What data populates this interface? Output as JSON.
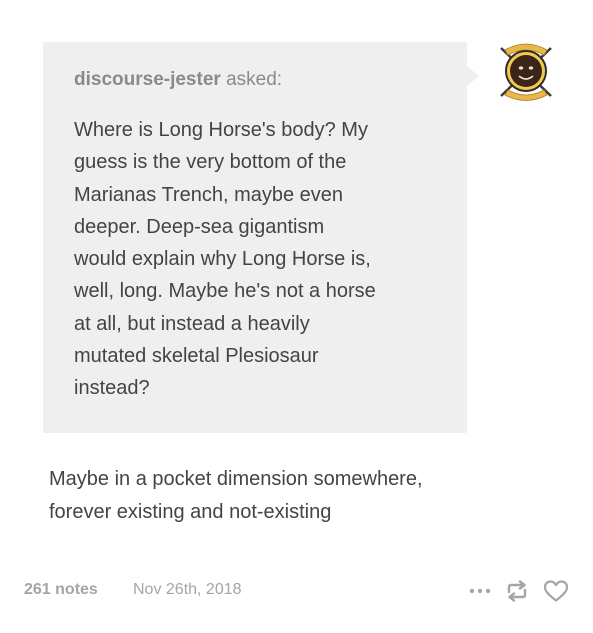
{
  "ask": {
    "asker": "discourse-jester",
    "asked_suffix": "asked:",
    "question": "Where is Long Horse's body? My\nguess is the very bottom of the\nMarianas Trench, maybe even\ndeeper. Deep-sea gigantism\nwould explain why Long Horse is,\nwell, long. Maybe he's not a horse\nat all, but instead a heavily\nmutated skeletal Plesiosaur\ninstead?"
  },
  "answer": {
    "text": "Maybe in a pocket dimension somewhere,\nforever existing and not-existing"
  },
  "footer": {
    "notes": "261 notes",
    "date": "Nov 26th, 2018",
    "icons": [
      "more-icon",
      "reblog-icon",
      "like-icon"
    ]
  },
  "colors": {
    "bubble_bg": "#efefef",
    "text": "#444444",
    "meta": "#a5a5a5",
    "asker": "#8a8a8a",
    "avatar_ring": "#f2c94c"
  }
}
